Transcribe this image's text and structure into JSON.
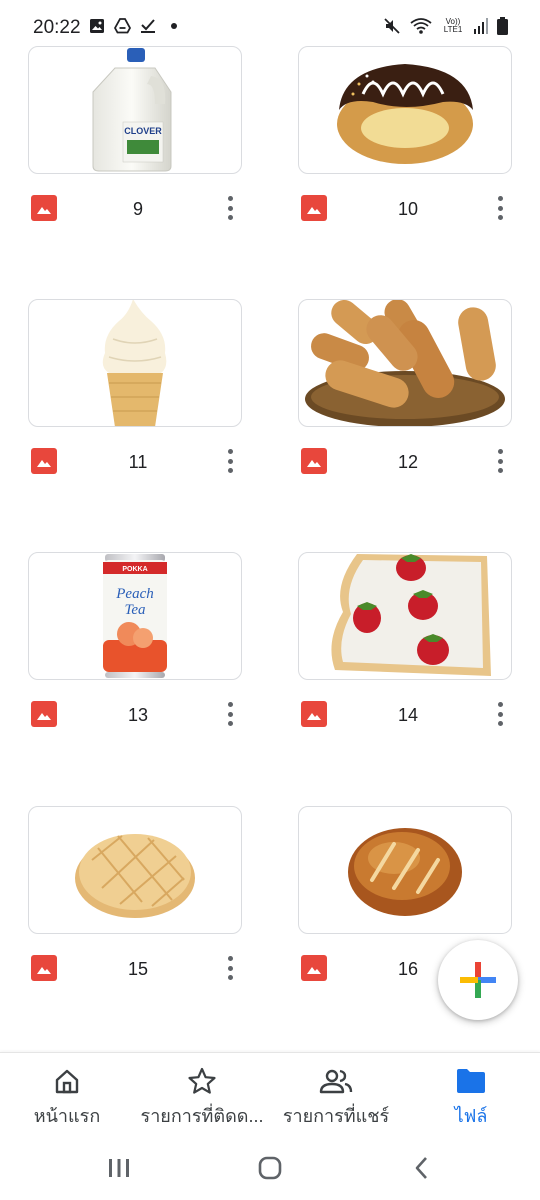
{
  "status_bar": {
    "time": "20:22",
    "network_label": "Vo)) LTE1"
  },
  "files": [
    {
      "name": "9",
      "thumbnail": "milk-jug",
      "brand": "CLOVER"
    },
    {
      "name": "10",
      "thumbnail": "chocolate-donut"
    },
    {
      "name": "11",
      "thumbnail": "soft-serve-cone"
    },
    {
      "name": "12",
      "thumbnail": "bread-basket"
    },
    {
      "name": "13",
      "thumbnail": "peach-tea-can",
      "brand": "POKKA",
      "title": "Peach Tea"
    },
    {
      "name": "14",
      "thumbnail": "strawberry-toast"
    },
    {
      "name": "15",
      "thumbnail": "melon-bun"
    },
    {
      "name": "16",
      "thumbnail": "bread-roll"
    }
  ],
  "bottom_nav": {
    "items": [
      {
        "label": "หน้าแรก",
        "icon": "home-icon"
      },
      {
        "label": "รายการที่ติดด...",
        "icon": "star-icon"
      },
      {
        "label": "รายการที่แชร์",
        "icon": "people-icon"
      },
      {
        "label": "ไฟล์",
        "icon": "folder-icon",
        "active": true
      }
    ]
  },
  "colors": {
    "accent": "#1a73e8",
    "image_icon": "#e8473c",
    "border": "#dadce0"
  }
}
